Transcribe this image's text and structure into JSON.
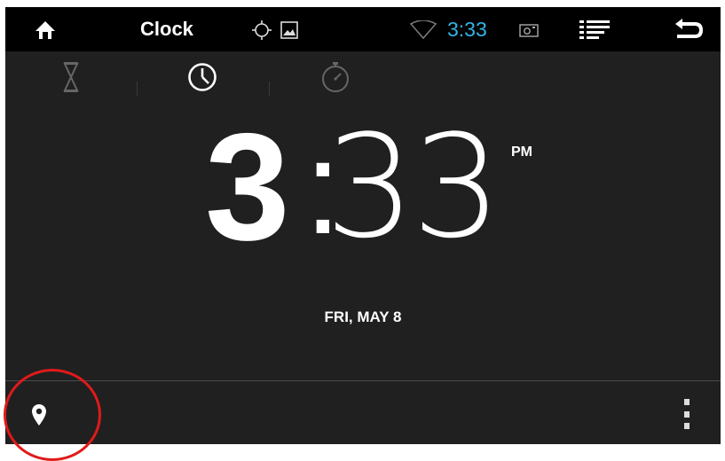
{
  "topbar": {
    "icons": {
      "home": "home-icon",
      "gps": "crosshair-icon",
      "image": "image-icon",
      "wifi": "wifi-icon",
      "camera": "screenshot-icon",
      "menu": "list-icon",
      "back": "back-icon"
    },
    "app_title": "Clock",
    "status_time": "3:33"
  },
  "tabs": [
    {
      "name": "timer",
      "icon": "hourglass-icon"
    },
    {
      "name": "clock",
      "icon": "clock-icon"
    },
    {
      "name": "stopwatch",
      "icon": "stopwatch-icon"
    }
  ],
  "clock": {
    "hour": "3",
    "separator": ":",
    "minutes": "33",
    "ampm": "PM",
    "date": "FRI, MAY 8"
  },
  "bottombar": {
    "left_icon": "location-pin-icon",
    "right_icon": "overflow-menu-icon"
  },
  "colors": {
    "status_accent": "#33b5e5",
    "highlight": "#e01a1a",
    "background": "#202020"
  }
}
